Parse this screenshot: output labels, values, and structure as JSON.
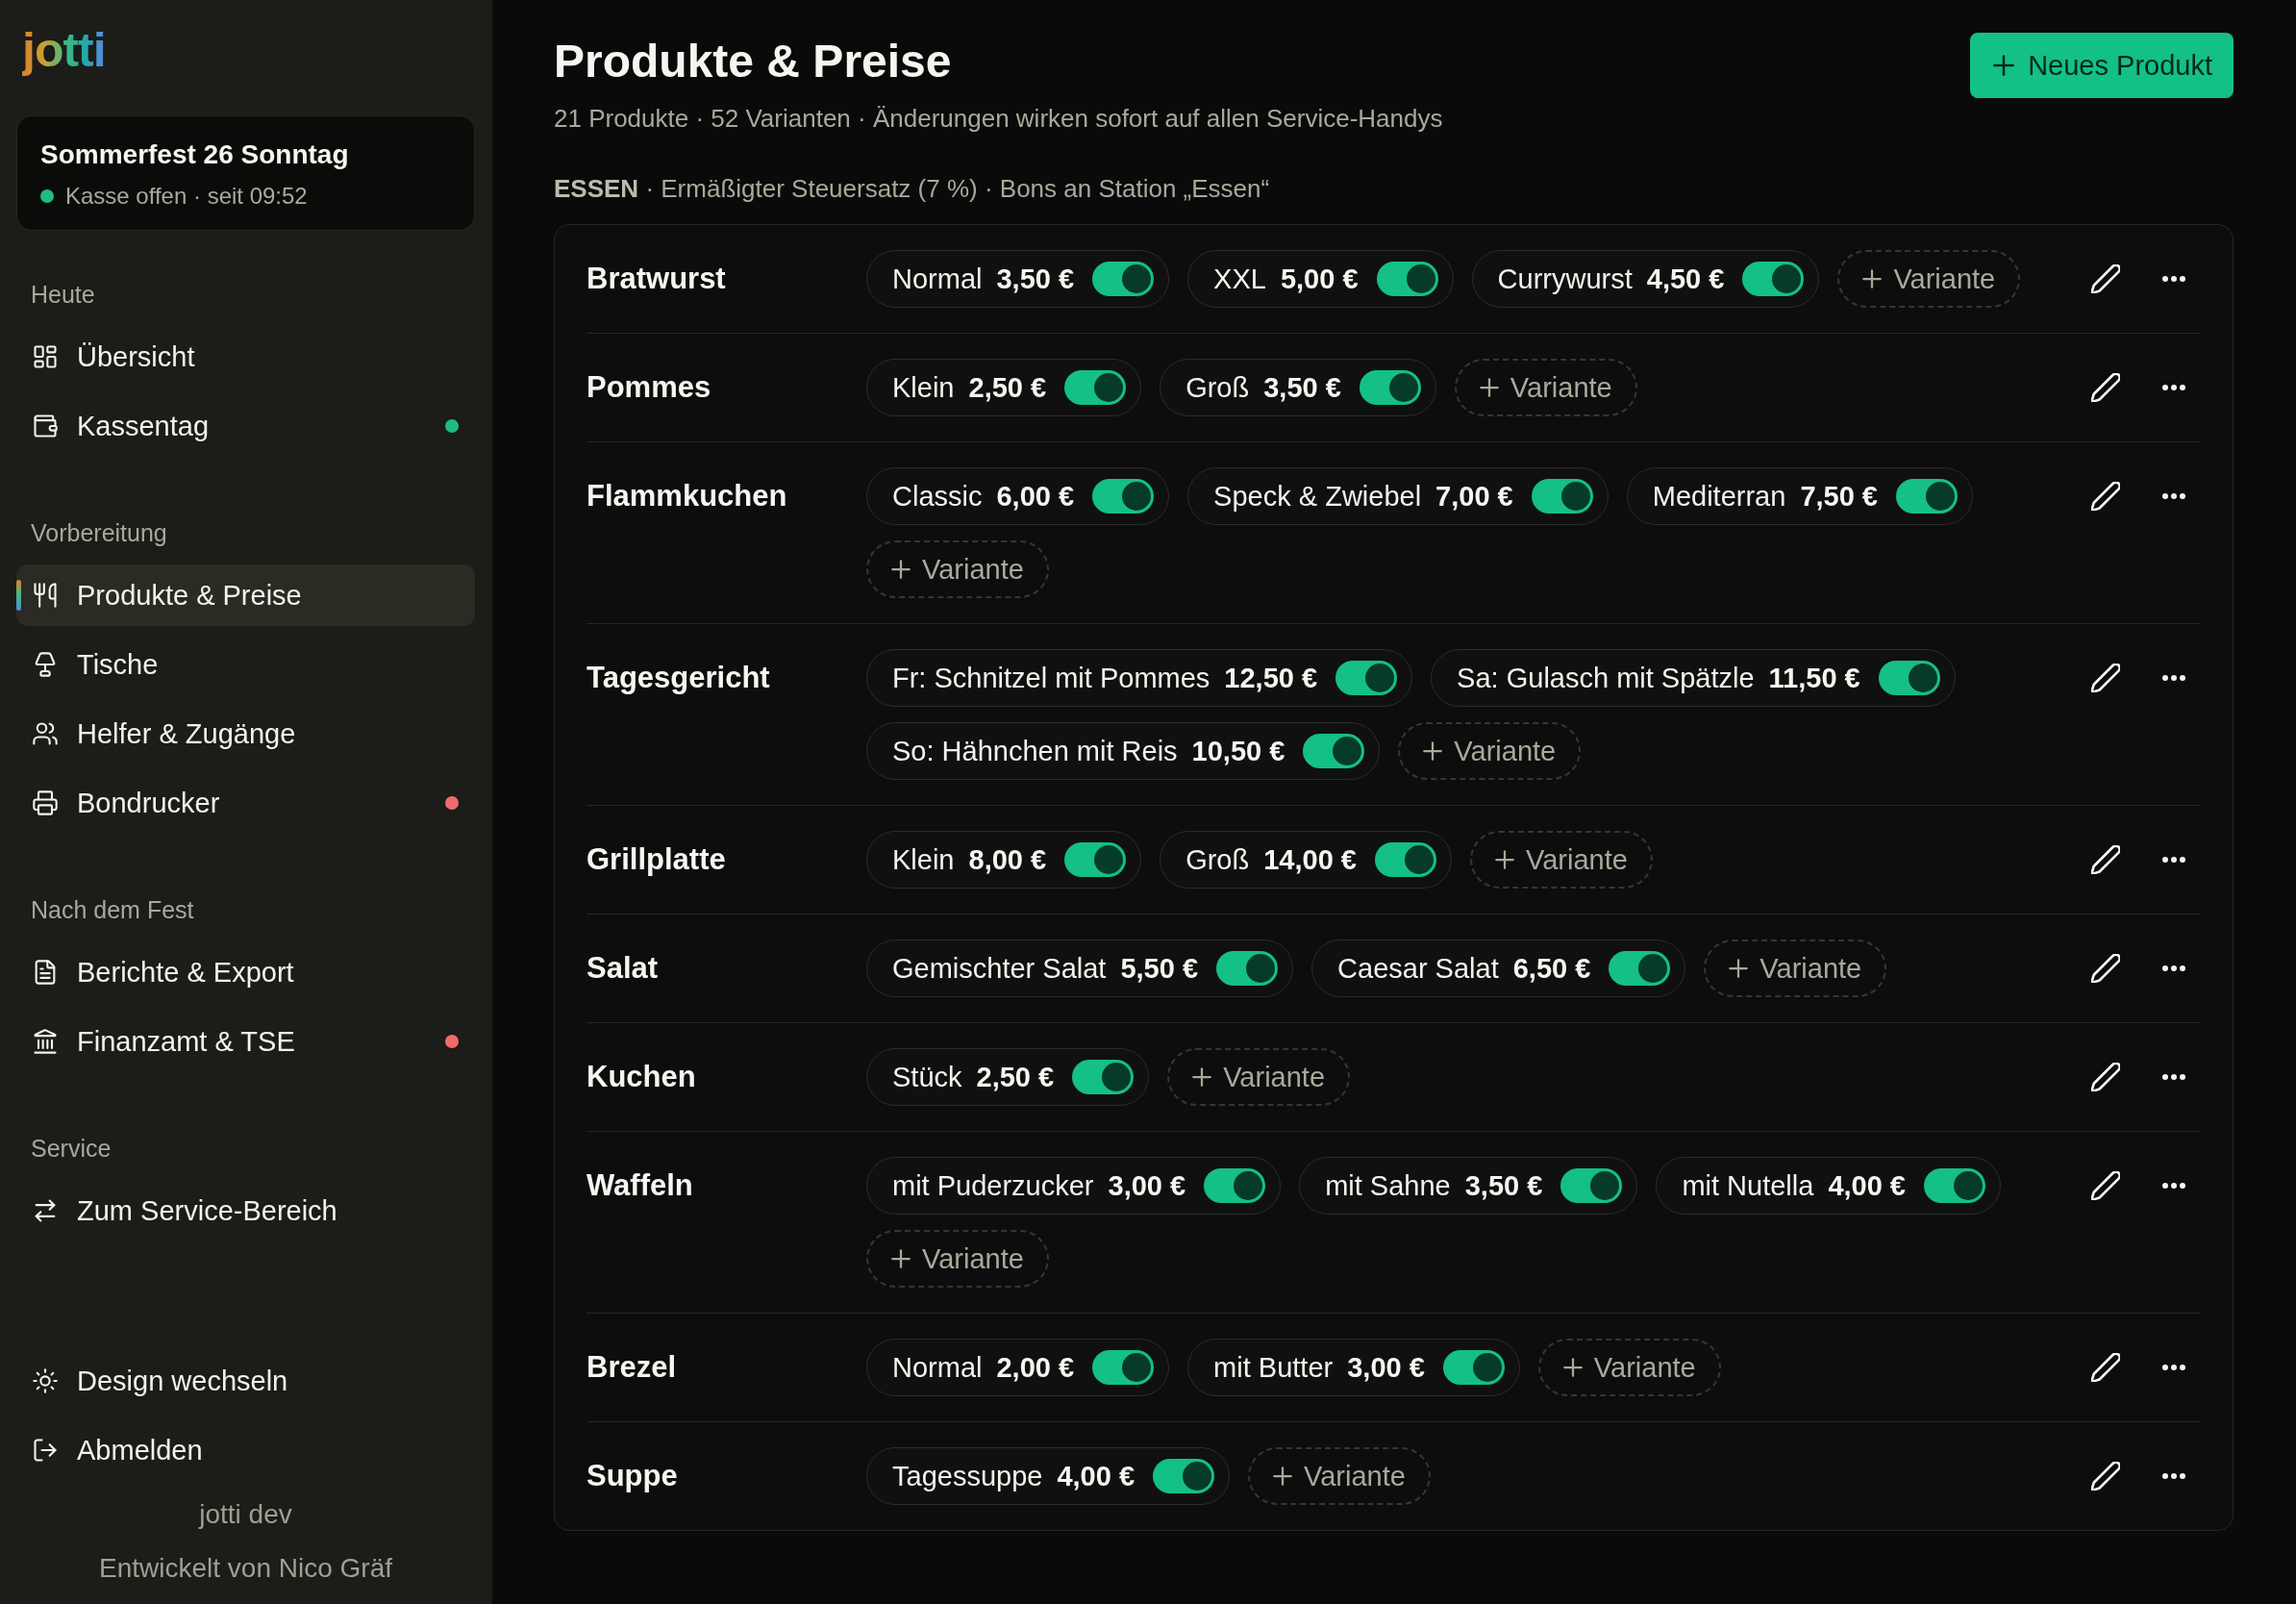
{
  "sidebar": {
    "logo": "jotti",
    "event": {
      "title": "Sommerfest 26 Sonntag",
      "status": "Kasse offen · seit 09:52",
      "open": true
    },
    "sections": [
      {
        "title": "Heute",
        "items": [
          {
            "label": "Übersicht",
            "selected": false
          },
          {
            "label": "Kassentag",
            "selected": false,
            "color": "#1dbd80"
          }
        ]
      },
      {
        "title": "Vorbereitung",
        "items": [
          {
            "label": "Produkte & Preise",
            "selected": true
          },
          {
            "label": "Tische",
            "selected": false
          },
          {
            "label": "Helfer & Zugänge",
            "selected": false
          },
          {
            "label": "Bondrucker",
            "selected": false,
            "color": "#f06b6b"
          }
        ]
      },
      {
        "title": "Nach dem Fest",
        "items": [
          {
            "label": "Berichte & Export",
            "selected": false
          },
          {
            "label": "Finanzamt & TSE",
            "selected": false,
            "color": "#f06b6b"
          }
        ]
      },
      {
        "title": "Service",
        "items": [
          {
            "label": "Zum Service-Bereich",
            "selected": false
          }
        ]
      }
    ],
    "footer_actions": [
      "Design wechseln",
      "Abmelden"
    ],
    "version": "jotti dev",
    "credit": "Entwickelt von Nico Gräf"
  },
  "header": {
    "title": "Produkte & Preise",
    "subtitle": "21 Produkte · 52 Varianten · Änderungen wirken sofort auf allen Service-Handys",
    "new_button": "Neues Produkt"
  },
  "category": {
    "info": "**ESSEN** · Ermäßigter Steuersatz (7 %) · Bons an Station „Essen“"
  },
  "products": [
    {
      "name": "Bratwurst",
      "variants": [
        {
          "name": "Normal",
          "price": "3,50 €",
          "on": true
        },
        {
          "name": "XXL",
          "price": "5,00 €",
          "on": true
        },
        {
          "name": "Currywurst",
          "price": "4,50 €",
          "on": true
        }
      ],
      "add_label": "Variante"
    },
    {
      "name": "Pommes",
      "variants": [
        {
          "name": "Klein",
          "price": "2,50 €",
          "on": true
        },
        {
          "name": "Groß",
          "price": "3,50 €",
          "on": true
        }
      ],
      "add_label": "Variante"
    },
    {
      "name": "Flammkuchen",
      "variants": [
        {
          "name": "Classic",
          "price": "6,00 €",
          "on": true
        },
        {
          "name": "Speck & Zwiebel",
          "price": "7,00 €",
          "on": true
        },
        {
          "name": "Mediterran",
          "price": "7,50 €",
          "on": true
        }
      ],
      "add_label": "Variante"
    },
    {
      "name": "Tagesgericht",
      "variants": [
        {
          "name": "Fr: Schnitzel mit Pommes",
          "price": "12,50 €",
          "on": true
        },
        {
          "name": "Sa: Gulasch mit Spätzle",
          "price": "11,50 €",
          "on": true
        },
        {
          "name": "So: Hähnchen mit Reis",
          "price": "10,50 €",
          "on": true
        }
      ],
      "add_label": "Variante"
    },
    {
      "name": "Grillplatte",
      "variants": [
        {
          "name": "Klein",
          "price": "8,00 €",
          "on": true
        },
        {
          "name": "Groß",
          "price": "14,00 €",
          "on": true
        }
      ],
      "add_label": "Variante"
    },
    {
      "name": "Salat",
      "variants": [
        {
          "name": "Gemischter Salat",
          "price": "5,50 €",
          "on": true
        },
        {
          "name": "Caesar Salat",
          "price": "6,50 €",
          "on": true
        }
      ],
      "add_label": "Variante"
    },
    {
      "name": "Kuchen",
      "variants": [
        {
          "name": "Stück",
          "price": "2,50 €",
          "on": true
        }
      ],
      "add_label": "Variante"
    },
    {
      "name": "Waffeln",
      "variants": [
        {
          "name": "mit Puderzucker",
          "price": "3,00 €",
          "on": true
        },
        {
          "name": "mit Sahne",
          "price": "3,50 €",
          "on": true
        },
        {
          "name": "mit Nutella",
          "price": "4,00 €",
          "on": true
        }
      ],
      "add_label": "Variante"
    },
    {
      "name": "Brezel",
      "variants": [
        {
          "name": "Normal",
          "price": "2,00 €",
          "on": true
        },
        {
          "name": "mit Butter",
          "price": "3,00 €",
          "on": true
        }
      ],
      "add_label": "Variante"
    },
    {
      "name": "Suppe",
      "variants": [
        {
          "name": "Tagessuppe",
          "price": "4,00 €",
          "on": true
        }
      ],
      "add_label": "Variante"
    }
  ]
}
